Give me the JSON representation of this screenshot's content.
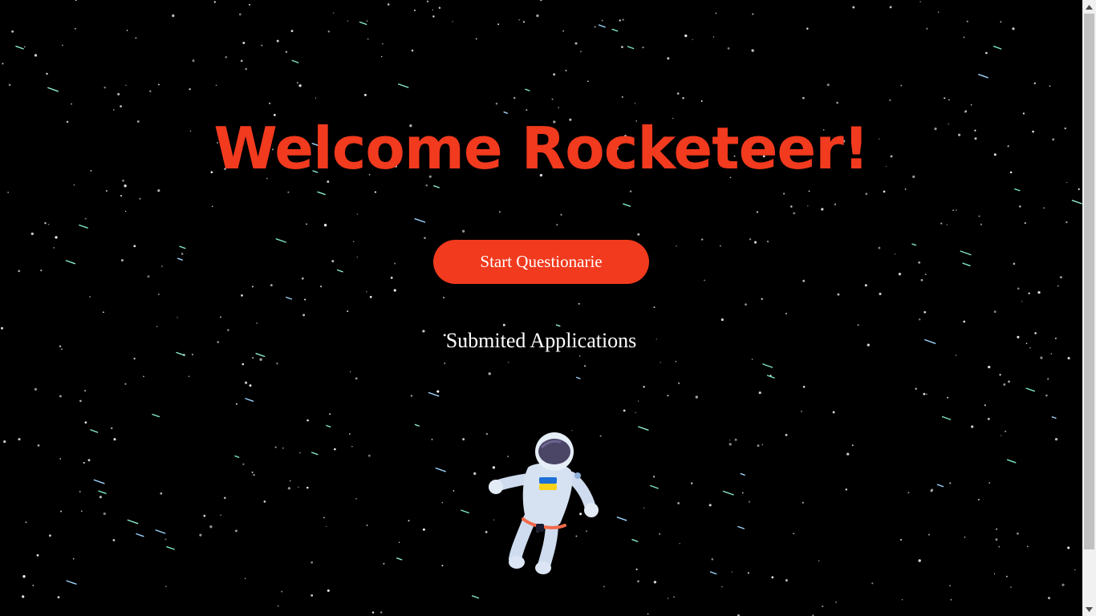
{
  "page": {
    "title": "Welcome Rocketeer!",
    "start_button_label": "Start Questionarie",
    "submitted_link_label": "Submited Applications"
  },
  "colors": {
    "background": "#000000",
    "accent": "#f23a1e",
    "button_text": "#ffffff",
    "link_text": "#ffffff"
  },
  "illustration": {
    "icon": "astronaut-icon",
    "flag": "ukraine-flag"
  }
}
